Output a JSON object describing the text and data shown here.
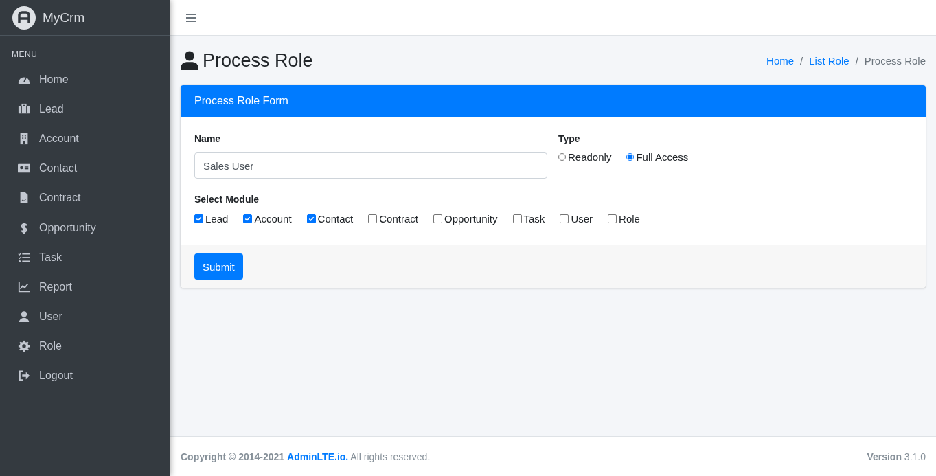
{
  "brand": {
    "name": "MyCrm"
  },
  "sidebar": {
    "header": "MENU",
    "items": [
      {
        "label": "Home"
      },
      {
        "label": "Lead"
      },
      {
        "label": "Account"
      },
      {
        "label": "Contact"
      },
      {
        "label": "Contract"
      },
      {
        "label": "Opportunity"
      },
      {
        "label": "Task"
      },
      {
        "label": "Report"
      },
      {
        "label": "User"
      },
      {
        "label": "Role"
      },
      {
        "label": "Logout"
      }
    ]
  },
  "page": {
    "title": "Process Role",
    "breadcrumb_separator": "/",
    "breadcrumb": [
      {
        "label": "Home",
        "link": true
      },
      {
        "label": "List Role",
        "link": true
      },
      {
        "label": "Process Role",
        "link": false
      }
    ]
  },
  "form": {
    "title": "Process Role Form",
    "name_label": "Name",
    "name_value": "Sales User",
    "type_label": "Type",
    "types": [
      {
        "label": "Readonly",
        "selected": false
      },
      {
        "label": "Full Access",
        "selected": true
      }
    ],
    "module_label": "Select Module",
    "modules": [
      {
        "label": "Lead",
        "checked": true
      },
      {
        "label": "Account",
        "checked": true
      },
      {
        "label": "Contact",
        "checked": true
      },
      {
        "label": "Contract",
        "checked": false
      },
      {
        "label": "Opportunity",
        "checked": false
      },
      {
        "label": "Task",
        "checked": false
      },
      {
        "label": "User",
        "checked": false
      },
      {
        "label": "Role",
        "checked": false
      }
    ],
    "submit": "Submit"
  },
  "footer": {
    "copyright": "Copyright © 2014-2021",
    "link": "AdminLTE.io.",
    "rest": "All rights reserved.",
    "version_label": "Version",
    "version": "3.1.0"
  }
}
